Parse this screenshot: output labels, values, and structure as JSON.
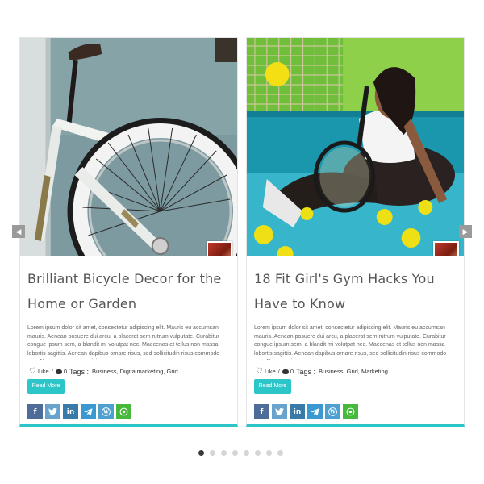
{
  "slider": {
    "prev_icon": "chevron-left-icon",
    "next_icon": "chevron-right-icon",
    "dots_total": 8,
    "active_dot": 1
  },
  "posts": [
    {
      "image": "bicycle-photo",
      "title": "Brilliant Bicycle Decor for the Home or Garden",
      "excerpt": "Lorem ipsum dolor sit amet, consectetur adipiscing elit. Mauris eu accumsan mauris. Aenean posuere dui arcu, a placerat sem rutrum vulputate. Curabitur congue ipsum sem, a blandit mi volutpat nec. Maecenas et tellus non massa lobortis sagittis. Aenean dapibus ornare risus, sed sollicitudin risus commodo non. Nam maximus non nisi",
      "like_label": "Like",
      "comment_count": "0",
      "tags_label": "Tags :",
      "tags": "Business, Digitalmarketing, Grid",
      "read_more": "Read More"
    },
    {
      "image": "tennis-player-photo",
      "title": "18 Fit Girl's Gym Hacks You Have to Know",
      "excerpt": "Lorem ipsum dolor sit amet, consectetur adipiscing elit. Mauris eu accumsan mauris. Aenean posuere dui arcu, a placerat sem rutrum vulputate. Curabitur congue ipsum sem, a blandit mi volutpat nec. Maecenas et tellus non massa lobortis sagittis. Aenean dapibus ornare risus, sed sollicitudin risus commodo non. Nam maximus non nisi",
      "like_label": "Like",
      "comment_count": "0",
      "tags_label": "Tags :",
      "tags": "Business, Grid, Marketing",
      "read_more": "Read More"
    }
  ],
  "share_icons": [
    "facebook-icon",
    "twitter-icon",
    "linkedin-icon",
    "telegram-icon",
    "wordpress-icon",
    "whatsapp-icon"
  ],
  "colors": {
    "accent": "#2cc5c8",
    "facebook": "#4d6c98",
    "twitter": "#67a3cc",
    "linkedin": "#3a7aa8",
    "telegram": "#3a99d1",
    "wordpress": "#4ea0d0",
    "whatsapp": "#46b83c"
  }
}
